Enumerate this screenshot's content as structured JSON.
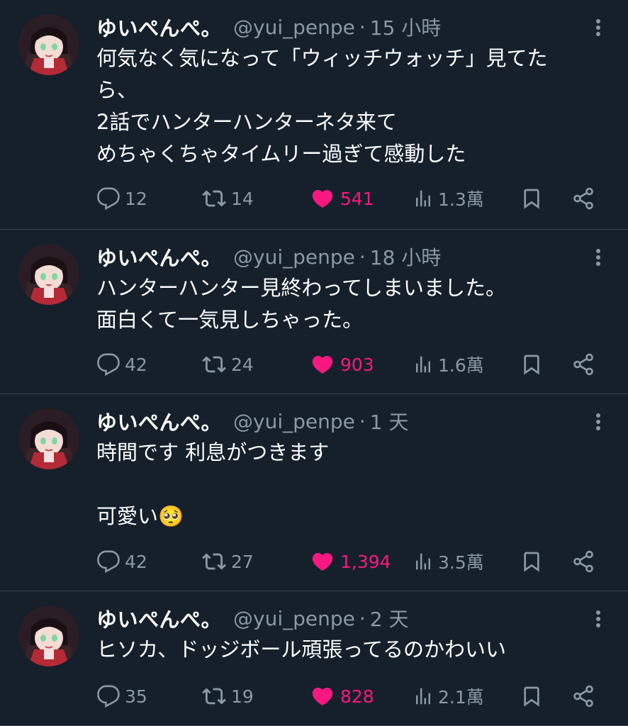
{
  "colors": {
    "background": "#15202b",
    "divider": "#38444d",
    "secondary_text": "#8b98a5",
    "like_active": "#f91880"
  },
  "tweets": [
    {
      "name": "ゆいぺんぺ。",
      "handle": "@yui_penpe",
      "separator": "·",
      "time": "15 小時",
      "lines": [
        "何気なく気になって「ウィッチウォッチ」見てた",
        "ら、",
        "2話でハンターハンターネタ来て",
        "めちゃくちゃタイムリー過ぎて感動した"
      ],
      "replies": "12",
      "retweets": "14",
      "likes": "541",
      "views": "1.3萬",
      "icons": [
        "reply-icon",
        "retweet-icon",
        "heart-icon",
        "views-icon",
        "bookmark-icon",
        "share-icon",
        "more-icon"
      ]
    },
    {
      "name": "ゆいぺんぺ。",
      "handle": "@yui_penpe",
      "separator": "·",
      "time": "18 小時",
      "lines": [
        "ハンターハンター見終わってしまいました。",
        "面白くて一気見しちゃった。"
      ],
      "replies": "42",
      "retweets": "24",
      "likes": "903",
      "views": "1.6萬"
    },
    {
      "name": "ゆいぺんぺ。",
      "handle": "@yui_penpe",
      "separator": "·",
      "time": "1 天",
      "lines": [
        "時間です 利息がつきます",
        "",
        "可愛い🥺"
      ],
      "replies": "42",
      "retweets": "27",
      "likes": "1,394",
      "views": "3.5萬"
    },
    {
      "name": "ゆいぺんぺ。",
      "handle": "@yui_penpe",
      "separator": "·",
      "time": "2 天",
      "lines": [
        "ヒソカ、ドッジボール頑張ってるのかわいい"
      ],
      "replies": "35",
      "retweets": "19",
      "likes": "828",
      "views": "2.1萬"
    }
  ]
}
